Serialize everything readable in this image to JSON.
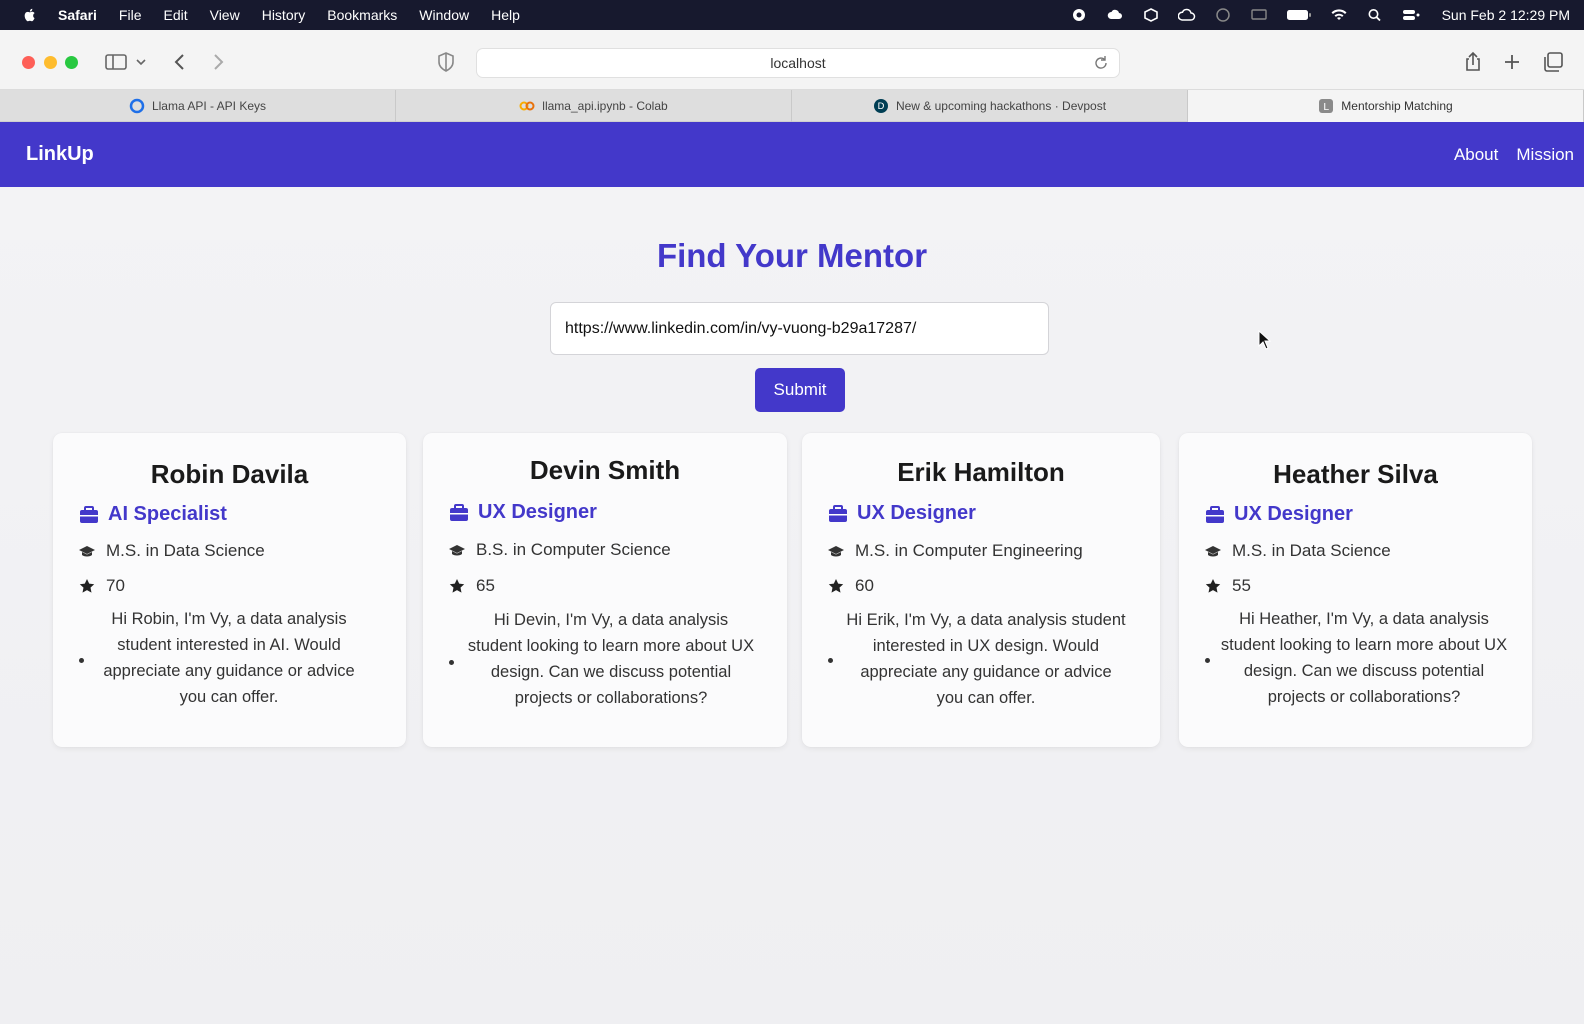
{
  "menubar": {
    "app_name": "Safari",
    "items": [
      "File",
      "Edit",
      "View",
      "History",
      "Bookmarks",
      "Window",
      "Help"
    ],
    "clock": "Sun Feb 2  12:29 PM",
    "status_icons": [
      "record-icon",
      "cloud-sync-icon",
      "box-icon",
      "cloud-icon",
      "globe-icon",
      "display-icon",
      "battery-icon",
      "wifi-icon",
      "search-icon",
      "control-center-icon"
    ]
  },
  "browser": {
    "url": "localhost",
    "tabs": [
      {
        "label": "Llama API - API Keys",
        "icon": "llama-icon",
        "color": "#1e6fe8"
      },
      {
        "label": "llama_api.ipynb - Colab",
        "icon": "colab-icon",
        "color": "#f9ab00"
      },
      {
        "label": "New & upcoming hackathons · Devpost",
        "icon": "devpost-icon",
        "color": "#003e54"
      },
      {
        "label": "Mentorship Matching",
        "icon": "page-icon",
        "color": "#8a8a8a"
      }
    ],
    "active_tab": 3
  },
  "app": {
    "brand": "LinkUp",
    "nav": {
      "about": "About",
      "mission": "Mission"
    },
    "title": "Find Your Mentor",
    "input_value": "https://www.linkedin.com/in/vy-vuong-b29a17287/",
    "submit_label": "Submit",
    "accent": "#4338ca"
  },
  "mentors": [
    {
      "name": "Robin Davila",
      "role": "AI Specialist",
      "education": "M.S. in Data Science",
      "score": "70",
      "message": "Hi Robin, I'm Vy, a data analysis student interested in AI. Would appreciate any guidance or advice you can offer."
    },
    {
      "name": "Devin Smith",
      "role": "UX Designer",
      "education": "B.S. in Computer Science",
      "score": "65",
      "message": "Hi Devin, I'm Vy, a data analysis student looking to learn more about UX design. Can we discuss potential projects or collaborations?"
    },
    {
      "name": "Erik Hamilton",
      "role": "UX Designer",
      "education": "M.S. in Computer Engineering",
      "score": "60",
      "message": "Hi Erik, I'm Vy, a data analysis student interested in UX design. Would appreciate any guidance or advice you can offer."
    },
    {
      "name": "Heather Silva",
      "role": "UX Designer",
      "education": "M.S. in Data Science",
      "score": "55",
      "message": "Hi Heather, I'm Vy, a data analysis student looking to learn more about UX design. Can we discuss potential projects or collaborations?"
    }
  ]
}
